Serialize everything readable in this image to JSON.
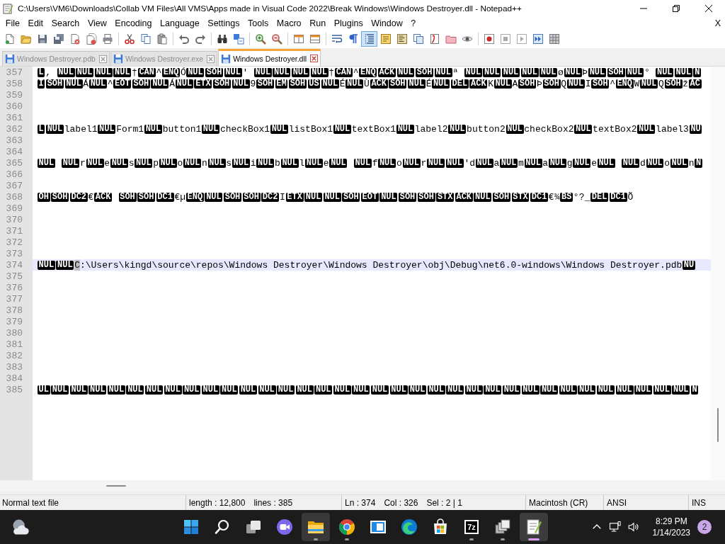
{
  "window": {
    "title": "C:\\Users\\VM6\\Downloads\\Collab VM Files\\All VMS\\Apps made in Visual Code 2022\\Break Windows\\Windows Destroyer.dll - Notepad++"
  },
  "menu": {
    "items": [
      "File",
      "Edit",
      "Search",
      "View",
      "Encoding",
      "Language",
      "Settings",
      "Tools",
      "Macro",
      "Run",
      "Plugins",
      "Window",
      "?"
    ],
    "close_document": "X"
  },
  "toolbar": [
    {
      "buttons": [
        {
          "kind": "new",
          "pressed": false
        },
        {
          "kind": "open",
          "pressed": false
        },
        {
          "kind": "save",
          "pressed": false
        },
        {
          "kind": "saveall",
          "pressed": false
        },
        {
          "kind": "close",
          "pressed": false
        },
        {
          "kind": "closeall",
          "pressed": false
        },
        {
          "kind": "print",
          "pressed": false
        }
      ]
    },
    {
      "buttons": [
        {
          "kind": "cut",
          "pressed": false
        },
        {
          "kind": "copy",
          "pressed": false
        },
        {
          "kind": "paste",
          "pressed": false
        }
      ]
    },
    {
      "buttons": [
        {
          "kind": "undo",
          "pressed": false
        },
        {
          "kind": "redo",
          "pressed": false
        }
      ]
    },
    {
      "buttons": [
        {
          "kind": "find",
          "pressed": false
        },
        {
          "kind": "replace",
          "pressed": false
        }
      ]
    },
    {
      "buttons": [
        {
          "kind": "zoomin",
          "pressed": false
        },
        {
          "kind": "zoomout",
          "pressed": false
        }
      ]
    },
    {
      "buttons": [
        {
          "kind": "syncv",
          "pressed": false
        },
        {
          "kind": "synch",
          "pressed": false
        }
      ]
    },
    {
      "buttons": [
        {
          "kind": "wrap",
          "pressed": false
        },
        {
          "kind": "allchars",
          "pressed": false
        },
        {
          "kind": "indent",
          "pressed": true
        },
        {
          "kind": "udl",
          "pressed": false
        },
        {
          "kind": "docmap",
          "pressed": false
        },
        {
          "kind": "doclist",
          "pressed": false
        },
        {
          "kind": "funclist",
          "pressed": false
        },
        {
          "kind": "folderws",
          "pressed": false
        },
        {
          "kind": "monitor",
          "pressed": false
        }
      ]
    },
    {
      "buttons": [
        {
          "kind": "record",
          "pressed": false
        },
        {
          "kind": "stop",
          "pressed": false
        },
        {
          "kind": "play",
          "pressed": false
        },
        {
          "kind": "playmulti",
          "pressed": false
        },
        {
          "kind": "savemacro",
          "pressed": false
        }
      ]
    }
  ],
  "tabs": [
    {
      "label": "Windows Destroyer.pdb",
      "selected": false
    },
    {
      "label": "Windows Destroyer.exe",
      "selected": false
    },
    {
      "label": "Windows Destroyer.dll",
      "selected": true
    }
  ],
  "editor": {
    "lines": [
      {
        "number": "357",
        "current": false,
        "segments": [
          {
            "kind": "ctrl",
            "text": "L"
          },
          {
            "kind": "text",
            "text": ", "
          },
          {
            "kind": "ctrl",
            "text": "NUL"
          },
          {
            "kind": "ctrl",
            "text": "NUL"
          },
          {
            "kind": "ctrl",
            "text": "NUL"
          },
          {
            "kind": "ctrl",
            "text": "NUL"
          },
          {
            "kind": "text",
            "text": "†"
          },
          {
            "kind": "ctrl",
            "text": "CAN"
          },
          {
            "kind": "text",
            "text": "^"
          },
          {
            "kind": "ctrl",
            "text": "ENQ"
          },
          {
            "kind": "text",
            "text": "Ó"
          },
          {
            "kind": "ctrl",
            "text": "NUL"
          },
          {
            "kind": "ctrl",
            "text": "SOH"
          },
          {
            "kind": "ctrl",
            "text": "NUL"
          },
          {
            "kind": "text",
            "text": "' "
          },
          {
            "kind": "ctrl",
            "text": "NUL"
          },
          {
            "kind": "ctrl",
            "text": "NUL"
          },
          {
            "kind": "ctrl",
            "text": "NUL"
          },
          {
            "kind": "ctrl",
            "text": "NUL"
          },
          {
            "kind": "text",
            "text": "†"
          },
          {
            "kind": "ctrl",
            "text": "CAN"
          },
          {
            "kind": "text",
            "text": "^"
          },
          {
            "kind": "ctrl",
            "text": "ENQ"
          },
          {
            "kind": "ctrl",
            "text": "ACK"
          },
          {
            "kind": "ctrl",
            "text": "NUL"
          },
          {
            "kind": "ctrl",
            "text": "SOH"
          },
          {
            "kind": "ctrl",
            "text": "NUL"
          },
          {
            "kind": "text",
            "text": "ª "
          },
          {
            "kind": "ctrl",
            "text": "NUL"
          },
          {
            "kind": "ctrl",
            "text": "NUL"
          },
          {
            "kind": "ctrl",
            "text": "NUL"
          },
          {
            "kind": "ctrl",
            "text": "NUL"
          },
          {
            "kind": "ctrl",
            "text": "NUL"
          },
          {
            "kind": "text",
            "text": "ø"
          },
          {
            "kind": "ctrl",
            "text": "NUL"
          },
          {
            "kind": "text",
            "text": "Þ"
          },
          {
            "kind": "ctrl",
            "text": "NUL"
          },
          {
            "kind": "ctrl",
            "text": "SOH"
          },
          {
            "kind": "ctrl",
            "text": "NUL"
          },
          {
            "kind": "text",
            "text": "° "
          },
          {
            "kind": "ctrl",
            "text": "NUL"
          },
          {
            "kind": "ctrl",
            "text": "NUL"
          },
          {
            "kind": "ctrl",
            "text": "N"
          }
        ]
      },
      {
        "number": "358",
        "current": false,
        "segments": [
          {
            "kind": "ctrl",
            "text": "I"
          },
          {
            "kind": "ctrl",
            "text": "SOH"
          },
          {
            "kind": "ctrl",
            "text": "NUL"
          },
          {
            "kind": "text",
            "text": "Á"
          },
          {
            "kind": "ctrl",
            "text": "NUL"
          },
          {
            "kind": "text",
            "text": "^"
          },
          {
            "kind": "ctrl",
            "text": "EOT"
          },
          {
            "kind": "ctrl",
            "text": "SOH"
          },
          {
            "kind": "ctrl",
            "text": "NUL"
          },
          {
            "kind": "text",
            "text": "Á"
          },
          {
            "kind": "ctrl",
            "text": "NUL"
          },
          {
            "kind": "ctrl",
            "text": "ETX"
          },
          {
            "kind": "ctrl",
            "text": "SOH"
          },
          {
            "kind": "ctrl",
            "text": "NUL"
          },
          {
            "kind": "text",
            "text": "9"
          },
          {
            "kind": "ctrl",
            "text": "SOH"
          },
          {
            "kind": "ctrl",
            "text": "EM"
          },
          {
            "kind": "ctrl",
            "text": "SOH"
          },
          {
            "kind": "ctrl",
            "text": "US"
          },
          {
            "kind": "ctrl",
            "text": "NUL"
          },
          {
            "kind": "text",
            "text": "É"
          },
          {
            "kind": "ctrl",
            "text": "NUL"
          },
          {
            "kind": "text",
            "text": "Ù"
          },
          {
            "kind": "ctrl",
            "text": "ACK"
          },
          {
            "kind": "ctrl",
            "text": "SOH"
          },
          {
            "kind": "ctrl",
            "text": "NUL"
          },
          {
            "kind": "text",
            "text": "É"
          },
          {
            "kind": "ctrl",
            "text": "NUL"
          },
          {
            "kind": "ctrl",
            "text": "DEL"
          },
          {
            "kind": "ctrl",
            "text": "ACK"
          },
          {
            "kind": "text",
            "text": "K"
          },
          {
            "kind": "ctrl",
            "text": "NUL"
          },
          {
            "kind": "text",
            "text": "A"
          },
          {
            "kind": "ctrl",
            "text": "SOH"
          },
          {
            "kind": "text",
            "text": "Þ"
          },
          {
            "kind": "ctrl",
            "text": "SOH"
          },
          {
            "kind": "text",
            "text": "Q"
          },
          {
            "kind": "ctrl",
            "text": "NUL"
          },
          {
            "kind": "text",
            "text": "I"
          },
          {
            "kind": "ctrl",
            "text": "SOH"
          },
          {
            "kind": "text",
            "text": "^"
          },
          {
            "kind": "ctrl",
            "text": "ENQ"
          },
          {
            "kind": "text",
            "text": "W"
          },
          {
            "kind": "ctrl",
            "text": "NUL"
          },
          {
            "kind": "text",
            "text": "Q"
          },
          {
            "kind": "ctrl",
            "text": "SOH"
          },
          {
            "kind": "text",
            "text": "ž"
          },
          {
            "kind": "ctrl",
            "text": "AC"
          }
        ]
      },
      {
        "number": "359",
        "current": false
      },
      {
        "number": "360",
        "current": false
      },
      {
        "number": "361",
        "current": false
      },
      {
        "number": "362",
        "current": false,
        "segments": [
          {
            "kind": "ctrl",
            "text": "L"
          },
          {
            "kind": "ctrl",
            "text": "NUL"
          },
          {
            "kind": "text",
            "text": "label1"
          },
          {
            "kind": "ctrl",
            "text": "NUL"
          },
          {
            "kind": "text",
            "text": "Form1"
          },
          {
            "kind": "ctrl",
            "text": "NUL"
          },
          {
            "kind": "text",
            "text": "button1"
          },
          {
            "kind": "ctrl",
            "text": "NUL"
          },
          {
            "kind": "text",
            "text": "checkBox1"
          },
          {
            "kind": "ctrl",
            "text": "NUL"
          },
          {
            "kind": "text",
            "text": "listBox1"
          },
          {
            "kind": "ctrl",
            "text": "NUL"
          },
          {
            "kind": "text",
            "text": "textBox1"
          },
          {
            "kind": "ctrl",
            "text": "NUL"
          },
          {
            "kind": "text",
            "text": "label2"
          },
          {
            "kind": "ctrl",
            "text": "NUL"
          },
          {
            "kind": "text",
            "text": "button2"
          },
          {
            "kind": "ctrl",
            "text": "NUL"
          },
          {
            "kind": "text",
            "text": "checkBox2"
          },
          {
            "kind": "ctrl",
            "text": "NUL"
          },
          {
            "kind": "text",
            "text": "textBox2"
          },
          {
            "kind": "ctrl",
            "text": "NUL"
          },
          {
            "kind": "text",
            "text": "label3"
          },
          {
            "kind": "ctrl",
            "text": "NU"
          }
        ]
      },
      {
        "number": "363",
        "current": false
      },
      {
        "number": "364",
        "current": false
      },
      {
        "number": "365",
        "current": false,
        "segments": [
          {
            "kind": "ctrl",
            "text": "NUL"
          },
          {
            "kind": "space"
          },
          {
            "kind": "ctrl",
            "text": "NUL"
          },
          {
            "kind": "text",
            "text": "r"
          },
          {
            "kind": "ctrl",
            "text": "NUL"
          },
          {
            "kind": "text",
            "text": "e"
          },
          {
            "kind": "ctrl",
            "text": "NUL"
          },
          {
            "kind": "text",
            "text": "s"
          },
          {
            "kind": "ctrl",
            "text": "NUL"
          },
          {
            "kind": "text",
            "text": "p"
          },
          {
            "kind": "ctrl",
            "text": "NUL"
          },
          {
            "kind": "text",
            "text": "o"
          },
          {
            "kind": "ctrl",
            "text": "NUL"
          },
          {
            "kind": "text",
            "text": "n"
          },
          {
            "kind": "ctrl",
            "text": "NUL"
          },
          {
            "kind": "text",
            "text": "s"
          },
          {
            "kind": "ctrl",
            "text": "NUL"
          },
          {
            "kind": "text",
            "text": "i"
          },
          {
            "kind": "ctrl",
            "text": "NUL"
          },
          {
            "kind": "text",
            "text": "b"
          },
          {
            "kind": "ctrl",
            "text": "NUL"
          },
          {
            "kind": "text",
            "text": "l"
          },
          {
            "kind": "ctrl",
            "text": "NUL"
          },
          {
            "kind": "text",
            "text": "e"
          },
          {
            "kind": "ctrl",
            "text": "NUL"
          },
          {
            "kind": "space"
          },
          {
            "kind": "ctrl",
            "text": "NUL"
          },
          {
            "kind": "text",
            "text": "f"
          },
          {
            "kind": "ctrl",
            "text": "NUL"
          },
          {
            "kind": "text",
            "text": "o"
          },
          {
            "kind": "ctrl",
            "text": "NUL"
          },
          {
            "kind": "text",
            "text": "r"
          },
          {
            "kind": "ctrl",
            "text": "NUL"
          },
          {
            "kind": "ctrl",
            "text": "NUL"
          },
          {
            "kind": "text",
            "text": "'d"
          },
          {
            "kind": "ctrl",
            "text": "NUL"
          },
          {
            "kind": "text",
            "text": "a"
          },
          {
            "kind": "ctrl",
            "text": "NUL"
          },
          {
            "kind": "text",
            "text": "m"
          },
          {
            "kind": "ctrl",
            "text": "NUL"
          },
          {
            "kind": "text",
            "text": "a"
          },
          {
            "kind": "ctrl",
            "text": "NUL"
          },
          {
            "kind": "text",
            "text": "g"
          },
          {
            "kind": "ctrl",
            "text": "NUL"
          },
          {
            "kind": "text",
            "text": "e"
          },
          {
            "kind": "ctrl",
            "text": "NUL"
          },
          {
            "kind": "space"
          },
          {
            "kind": "ctrl",
            "text": "NUL"
          },
          {
            "kind": "text",
            "text": "d"
          },
          {
            "kind": "ctrl",
            "text": "NUL"
          },
          {
            "kind": "text",
            "text": "o"
          },
          {
            "kind": "ctrl",
            "text": "NUL"
          },
          {
            "kind": "text",
            "text": "n"
          },
          {
            "kind": "ctrl",
            "text": "N"
          }
        ]
      },
      {
        "number": "366",
        "current": false
      },
      {
        "number": "367",
        "current": false
      },
      {
        "number": "368",
        "current": false,
        "segments": [
          {
            "kind": "ctrl",
            "text": "OH"
          },
          {
            "kind": "ctrl",
            "text": "SOH"
          },
          {
            "kind": "ctrl",
            "text": "DC2"
          },
          {
            "kind": "text",
            "text": "€"
          },
          {
            "kind": "ctrl",
            "text": "ACK"
          },
          {
            "kind": "space"
          },
          {
            "kind": "ctrl",
            "text": "SOH"
          },
          {
            "kind": "ctrl",
            "text": "SOH"
          },
          {
            "kind": "ctrl",
            "text": "DC1"
          },
          {
            "kind": "text",
            "text": "€µ"
          },
          {
            "kind": "ctrl",
            "text": "ENQ"
          },
          {
            "kind": "ctrl",
            "text": "NUL"
          },
          {
            "kind": "ctrl",
            "text": "SOH"
          },
          {
            "kind": "ctrl",
            "text": "SOH"
          },
          {
            "kind": "ctrl",
            "text": "DC2"
          },
          {
            "kind": "text",
            "text": "I"
          },
          {
            "kind": "ctrl",
            "text": "ETX"
          },
          {
            "kind": "ctrl",
            "text": "NUL"
          },
          {
            "kind": "ctrl",
            "text": "NUL"
          },
          {
            "kind": "ctrl",
            "text": "SOH"
          },
          {
            "kind": "ctrl",
            "text": "EOT"
          },
          {
            "kind": "ctrl",
            "text": "NUL"
          },
          {
            "kind": "ctrl",
            "text": "SOH"
          },
          {
            "kind": "ctrl",
            "text": "SOH"
          },
          {
            "kind": "ctrl",
            "text": "STX"
          },
          {
            "kind": "ctrl",
            "text": "ACK"
          },
          {
            "kind": "ctrl",
            "text": "NUL"
          },
          {
            "kind": "ctrl",
            "text": "SOH"
          },
          {
            "kind": "ctrl",
            "text": "STX"
          },
          {
            "kind": "ctrl",
            "text": "DC1"
          },
          {
            "kind": "text",
            "text": "€¾"
          },
          {
            "kind": "ctrl",
            "text": "BS"
          },
          {
            "kind": "text",
            "text": "°?_"
          },
          {
            "kind": "ctrl",
            "text": "DEL"
          },
          {
            "kind": "ctrl",
            "text": "DC1"
          },
          {
            "kind": "text",
            "text": "Õ"
          }
        ]
      },
      {
        "number": "369",
        "current": false
      },
      {
        "number": "370",
        "current": false
      },
      {
        "number": "371",
        "current": false
      },
      {
        "number": "372",
        "current": false
      },
      {
        "number": "373",
        "current": false
      },
      {
        "number": "374",
        "current": true,
        "segments": [
          {
            "kind": "ctrl",
            "text": "NUL"
          },
          {
            "kind": "ctrl",
            "text": "NUL"
          },
          {
            "kind": "selection",
            "text": "C"
          },
          {
            "kind": "text",
            "text": ":\\Users\\kingd\\source\\repos\\Windows Destroyer\\Windows Destroyer\\obj\\Debug\\net6.0-windows\\Windows Destroyer.pdb"
          },
          {
            "kind": "ctrl",
            "text": "NU"
          }
        ]
      },
      {
        "number": "375",
        "current": false
      },
      {
        "number": "376",
        "current": false
      },
      {
        "number": "377",
        "current": false
      },
      {
        "number": "378",
        "current": false
      },
      {
        "number": "379",
        "current": false
      },
      {
        "number": "380",
        "current": false
      },
      {
        "number": "381",
        "current": false
      },
      {
        "number": "382",
        "current": false
      },
      {
        "number": "383",
        "current": false
      },
      {
        "number": "384",
        "current": false
      },
      {
        "number": "385",
        "current": false,
        "segments": [
          {
            "kind": "ctrl",
            "text": "UL"
          },
          {
            "kind": "ctrl",
            "text": "NUL"
          },
          {
            "kind": "ctrl",
            "text": "NUL"
          },
          {
            "kind": "ctrl",
            "text": "NUL"
          },
          {
            "kind": "ctrl",
            "text": "NUL"
          },
          {
            "kind": "ctrl",
            "text": "NUL"
          },
          {
            "kind": "ctrl",
            "text": "NUL"
          },
          {
            "kind": "ctrl",
            "text": "NUL"
          },
          {
            "kind": "ctrl",
            "text": "NUL"
          },
          {
            "kind": "ctrl",
            "text": "NUL"
          },
          {
            "kind": "ctrl",
            "text": "NUL"
          },
          {
            "kind": "ctrl",
            "text": "NUL"
          },
          {
            "kind": "ctrl",
            "text": "NUL"
          },
          {
            "kind": "ctrl",
            "text": "NUL"
          },
          {
            "kind": "ctrl",
            "text": "NUL"
          },
          {
            "kind": "ctrl",
            "text": "NUL"
          },
          {
            "kind": "ctrl",
            "text": "NUL"
          },
          {
            "kind": "ctrl",
            "text": "NUL"
          },
          {
            "kind": "ctrl",
            "text": "NUL"
          },
          {
            "kind": "ctrl",
            "text": "NUL"
          },
          {
            "kind": "ctrl",
            "text": "NUL"
          },
          {
            "kind": "ctrl",
            "text": "NUL"
          },
          {
            "kind": "ctrl",
            "text": "NUL"
          },
          {
            "kind": "ctrl",
            "text": "NUL"
          },
          {
            "kind": "ctrl",
            "text": "NUL"
          },
          {
            "kind": "ctrl",
            "text": "NUL"
          },
          {
            "kind": "ctrl",
            "text": "NUL"
          },
          {
            "kind": "ctrl",
            "text": "NUL"
          },
          {
            "kind": "ctrl",
            "text": "NUL"
          },
          {
            "kind": "ctrl",
            "text": "NUL"
          },
          {
            "kind": "ctrl",
            "text": "NUL"
          },
          {
            "kind": "ctrl",
            "text": "NUL"
          },
          {
            "kind": "ctrl",
            "text": "NUL"
          },
          {
            "kind": "ctrl",
            "text": "NUL"
          },
          {
            "kind": "ctrl",
            "text": "NUL"
          },
          {
            "kind": "ctrl",
            "text": "N"
          }
        ]
      }
    ]
  },
  "status_bar": {
    "sections": [
      {
        "fields": [
          "Normal text file"
        ]
      },
      {
        "fields": [
          "length : 12,800",
          "lines : 385"
        ]
      },
      {
        "fields": [
          "Ln : 374",
          "Col : 326",
          "Sel : 2 | 1"
        ]
      },
      {
        "fields": [
          "Macintosh (CR)"
        ]
      },
      {
        "fields": [
          "ANSI"
        ]
      },
      {
        "fields": [
          "INS"
        ]
      }
    ]
  },
  "taskbar": {
    "apps": [
      {
        "kind": "start",
        "running": false,
        "active": false,
        "hovered": false
      },
      {
        "kind": "search",
        "running": false,
        "active": false,
        "hovered": false
      },
      {
        "kind": "taskview",
        "running": false,
        "active": false,
        "hovered": false
      },
      {
        "kind": "chat",
        "running": false,
        "active": false,
        "hovered": false
      },
      {
        "kind": "explorer",
        "running": true,
        "active": false,
        "hovered": true
      },
      {
        "kind": "chrome",
        "running": true,
        "active": false,
        "hovered": false
      },
      {
        "kind": "sandbox",
        "running": false,
        "active": false,
        "hovered": false
      },
      {
        "kind": "edge",
        "running": false,
        "active": false,
        "hovered": false
      },
      {
        "kind": "store",
        "running": false,
        "active": false,
        "hovered": false
      },
      {
        "kind": "archiver",
        "label": "7z",
        "running": true,
        "active": false,
        "hovered": false
      },
      {
        "kind": "stacked",
        "running": true,
        "active": false,
        "hovered": false
      },
      {
        "kind": "notepad",
        "running": true,
        "active": true,
        "hovered": false
      }
    ],
    "clock": {
      "time": "8:29 PM",
      "date": "1/14/2023"
    },
    "notification_count": "2"
  }
}
